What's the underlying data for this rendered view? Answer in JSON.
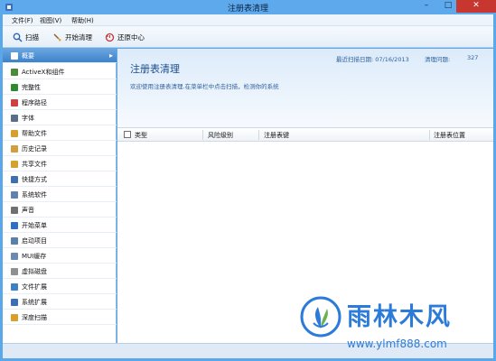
{
  "window": {
    "title": "注册表清理",
    "controls": {
      "minimize": "–",
      "maximize": "□",
      "close": "✕"
    }
  },
  "menu": {
    "items": [
      {
        "label": "文件(F)"
      },
      {
        "label": "视图(V)"
      },
      {
        "label": "帮助(H)"
      }
    ]
  },
  "toolbar": {
    "scan_label": "扫描",
    "clean_label": "开始清理",
    "restore_label": "还原中心"
  },
  "sidebar": {
    "items": [
      {
        "label": "概要",
        "icon": "summary-icon",
        "color": "#ffffff"
      },
      {
        "label": "ActiveX和组件",
        "icon": "activex-icon",
        "color": "#4a8a3a"
      },
      {
        "label": "完整性",
        "icon": "integrity-icon",
        "color": "#2e8a2e"
      },
      {
        "label": "程序路径",
        "icon": "program-path-icon",
        "color": "#d04040"
      },
      {
        "label": "字体",
        "icon": "font-icon",
        "color": "#5a6d8a"
      },
      {
        "label": "帮助文件",
        "icon": "help-file-icon",
        "color": "#d6a030"
      },
      {
        "label": "历史记录",
        "icon": "history-icon",
        "color": "#d0a040"
      },
      {
        "label": "共享文件",
        "icon": "shared-file-icon",
        "color": "#d6a030"
      },
      {
        "label": "快捷方式",
        "icon": "shortcut-icon",
        "color": "#4070b0"
      },
      {
        "label": "系统软件",
        "icon": "system-software-icon",
        "color": "#6080b0"
      },
      {
        "label": "声音",
        "icon": "sound-icon",
        "color": "#707070"
      },
      {
        "label": "开始菜单",
        "icon": "start-menu-icon",
        "color": "#3070c0"
      },
      {
        "label": "启动项目",
        "icon": "startup-icon",
        "color": "#5a7fa8"
      },
      {
        "label": "MUI缓存",
        "icon": "mui-cache-icon",
        "color": "#6a8ab0"
      },
      {
        "label": "虚拟磁盘",
        "icon": "virtual-disk-icon",
        "color": "#909090"
      },
      {
        "label": "文件扩展",
        "icon": "file-extension-icon",
        "color": "#4080c0"
      },
      {
        "label": "系统扩展",
        "icon": "system-extension-icon",
        "color": "#3a70b8"
      },
      {
        "label": "深度扫描",
        "icon": "deep-scan-icon",
        "color": "#d6a030"
      }
    ]
  },
  "main": {
    "title": "注册表清理",
    "description": "欢迎使用注册表清理.在菜单栏中点击扫描，检测你的系统",
    "last_scan_label": "最近扫描日期: 07/16/2013",
    "issues_label": "清理问题:",
    "issues_count": "327"
  },
  "table": {
    "columns": [
      "类型",
      "风险级别",
      "注册表键",
      "注册表位置"
    ]
  },
  "watermark": {
    "name": "雨林木风",
    "url": "www.ylmf888.com"
  },
  "colors": {
    "accent": "#3d82cc",
    "window_frame": "#5aa8ea",
    "watermark": "#2d7bd8"
  }
}
